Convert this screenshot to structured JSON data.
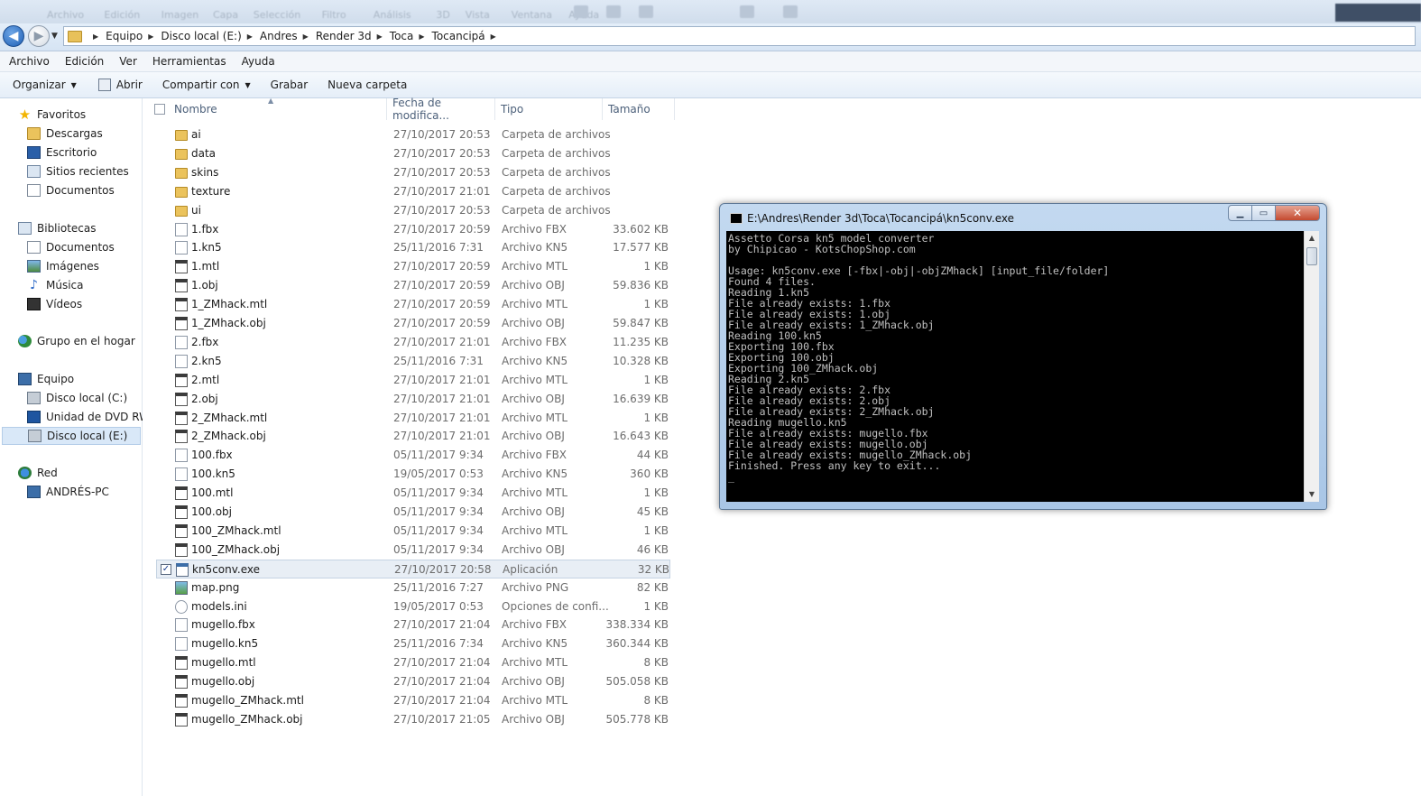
{
  "background_app": {
    "menu": [
      "Archivo",
      "Edición",
      "Imagen",
      "Capa",
      "Selección",
      "Filtro",
      "Análisis",
      "3D",
      "Vista",
      "Ventana",
      "Ayuda"
    ]
  },
  "nav": {
    "back_glyph": "◀",
    "forward_glyph": "▶",
    "dropdown_glyph": "▼"
  },
  "breadcrumb": [
    "Equipo",
    "Disco local (E:)",
    "Andres",
    "Render 3d",
    "Toca",
    "Tocancipá"
  ],
  "breadcrumb_sep": "▶",
  "menubar": [
    "Archivo",
    "Edición",
    "Ver",
    "Herramientas",
    "Ayuda"
  ],
  "toolbar": {
    "organize": "Organizar",
    "open": "Abrir",
    "share": "Compartir con",
    "burn": "Grabar",
    "new_folder": "Nueva carpeta",
    "drop_glyph": "▼"
  },
  "navpane": {
    "favorites": "Favoritos",
    "downloads": "Descargas",
    "desktop": "Escritorio",
    "recent": "Sitios recientes",
    "documents_fav": "Documentos",
    "libraries": "Bibliotecas",
    "documents": "Documentos",
    "images": "Imágenes",
    "music": "Música",
    "videos": "Vídeos",
    "homegroup": "Grupo en el hogar",
    "computer": "Equipo",
    "drive_c": "Disco local (C:)",
    "dvd": "Unidad de DVD RW (",
    "drive_e": "Disco local (E:)",
    "network": "Red",
    "pc": "ANDRÉS-PC"
  },
  "columns": {
    "name": "Nombre",
    "date": "Fecha de modifica...",
    "type": "Tipo",
    "size": "Tamaño"
  },
  "files": [
    {
      "name": "ai",
      "date": "27/10/2017 20:53",
      "type": "Carpeta de archivos",
      "size": "",
      "icon": "folder"
    },
    {
      "name": "data",
      "date": "27/10/2017 20:53",
      "type": "Carpeta de archivos",
      "size": "",
      "icon": "folder"
    },
    {
      "name": "skins",
      "date": "27/10/2017 20:53",
      "type": "Carpeta de archivos",
      "size": "",
      "icon": "folder"
    },
    {
      "name": "texture",
      "date": "27/10/2017 21:01",
      "type": "Carpeta de archivos",
      "size": "",
      "icon": "folder"
    },
    {
      "name": "ui",
      "date": "27/10/2017 20:53",
      "type": "Carpeta de archivos",
      "size": "",
      "icon": "folder"
    },
    {
      "name": "1.fbx",
      "date": "27/10/2017 20:59",
      "type": "Archivo FBX",
      "size": "33.602 KB",
      "icon": "blank"
    },
    {
      "name": "1.kn5",
      "date": "25/11/2016 7:31",
      "type": "Archivo KN5",
      "size": "17.577 KB",
      "icon": "blank"
    },
    {
      "name": "1.mtl",
      "date": "27/10/2017 20:59",
      "type": "Archivo MTL",
      "size": "1 KB",
      "icon": "text"
    },
    {
      "name": "1.obj",
      "date": "27/10/2017 20:59",
      "type": "Archivo OBJ",
      "size": "59.836 KB",
      "icon": "text"
    },
    {
      "name": "1_ZMhack.mtl",
      "date": "27/10/2017 20:59",
      "type": "Archivo MTL",
      "size": "1 KB",
      "icon": "text"
    },
    {
      "name": "1_ZMhack.obj",
      "date": "27/10/2017 20:59",
      "type": "Archivo OBJ",
      "size": "59.847 KB",
      "icon": "text"
    },
    {
      "name": "2.fbx",
      "date": "27/10/2017 21:01",
      "type": "Archivo FBX",
      "size": "11.235 KB",
      "icon": "blank"
    },
    {
      "name": "2.kn5",
      "date": "25/11/2016 7:31",
      "type": "Archivo KN5",
      "size": "10.328 KB",
      "icon": "blank"
    },
    {
      "name": "2.mtl",
      "date": "27/10/2017 21:01",
      "type": "Archivo MTL",
      "size": "1 KB",
      "icon": "text"
    },
    {
      "name": "2.obj",
      "date": "27/10/2017 21:01",
      "type": "Archivo OBJ",
      "size": "16.639 KB",
      "icon": "text"
    },
    {
      "name": "2_ZMhack.mtl",
      "date": "27/10/2017 21:01",
      "type": "Archivo MTL",
      "size": "1 KB",
      "icon": "text"
    },
    {
      "name": "2_ZMhack.obj",
      "date": "27/10/2017 21:01",
      "type": "Archivo OBJ",
      "size": "16.643 KB",
      "icon": "text"
    },
    {
      "name": "100.fbx",
      "date": "05/11/2017 9:34",
      "type": "Archivo FBX",
      "size": "44 KB",
      "icon": "blank"
    },
    {
      "name": "100.kn5",
      "date": "19/05/2017 0:53",
      "type": "Archivo KN5",
      "size": "360 KB",
      "icon": "blank"
    },
    {
      "name": "100.mtl",
      "date": "05/11/2017 9:34",
      "type": "Archivo MTL",
      "size": "1 KB",
      "icon": "text"
    },
    {
      "name": "100.obj",
      "date": "05/11/2017 9:34",
      "type": "Archivo OBJ",
      "size": "45 KB",
      "icon": "text"
    },
    {
      "name": "100_ZMhack.mtl",
      "date": "05/11/2017 9:34",
      "type": "Archivo MTL",
      "size": "1 KB",
      "icon": "text"
    },
    {
      "name": "100_ZMhack.obj",
      "date": "05/11/2017 9:34",
      "type": "Archivo OBJ",
      "size": "46 KB",
      "icon": "text"
    },
    {
      "name": "kn5conv.exe",
      "date": "27/10/2017 20:58",
      "type": "Aplicación",
      "size": "32 KB",
      "icon": "exe",
      "selected": true
    },
    {
      "name": "map.png",
      "date": "25/11/2016 7:27",
      "type": "Archivo PNG",
      "size": "82 KB",
      "icon": "png"
    },
    {
      "name": "models.ini",
      "date": "19/05/2017 0:53",
      "type": "Opciones de confi...",
      "size": "1 KB",
      "icon": "ini"
    },
    {
      "name": "mugello.fbx",
      "date": "27/10/2017 21:04",
      "type": "Archivo FBX",
      "size": "338.334 KB",
      "icon": "blank"
    },
    {
      "name": "mugello.kn5",
      "date": "25/11/2016 7:34",
      "type": "Archivo KN5",
      "size": "360.344 KB",
      "icon": "blank"
    },
    {
      "name": "mugello.mtl",
      "date": "27/10/2017 21:04",
      "type": "Archivo MTL",
      "size": "8 KB",
      "icon": "text"
    },
    {
      "name": "mugello.obj",
      "date": "27/10/2017 21:04",
      "type": "Archivo OBJ",
      "size": "505.058 KB",
      "icon": "text"
    },
    {
      "name": "mugello_ZMhack.mtl",
      "date": "27/10/2017 21:04",
      "type": "Archivo MTL",
      "size": "8 KB",
      "icon": "text"
    },
    {
      "name": "mugello_ZMhack.obj",
      "date": "27/10/2017 21:05",
      "type": "Archivo OBJ",
      "size": "505.778 KB",
      "icon": "text"
    }
  ],
  "console": {
    "title": "E:\\Andres\\Render 3d\\Toca\\Tocancipá\\kn5conv.exe",
    "close_glyph": "✕",
    "text": "Assetto Corsa kn5 model converter\nby Chipicao - KotsChopShop.com\n\nUsage: kn5conv.exe [-fbx|-obj|-objZMhack] [input_file/folder]\nFound 4 files.\nReading 1.kn5\nFile already exists: 1.fbx\nFile already exists: 1.obj\nFile already exists: 1_ZMhack.obj\nReading 100.kn5\nExporting 100.fbx\nExporting 100.obj\nExporting 100_ZMhack.obj\nReading 2.kn5\nFile already exists: 2.fbx\nFile already exists: 2.obj\nFile already exists: 2_ZMhack.obj\nReading mugello.kn5\nFile already exists: mugello.fbx\nFile already exists: mugello.obj\nFile already exists: mugello_ZMhack.obj\nFinished. Press any key to exit...\n_"
  }
}
